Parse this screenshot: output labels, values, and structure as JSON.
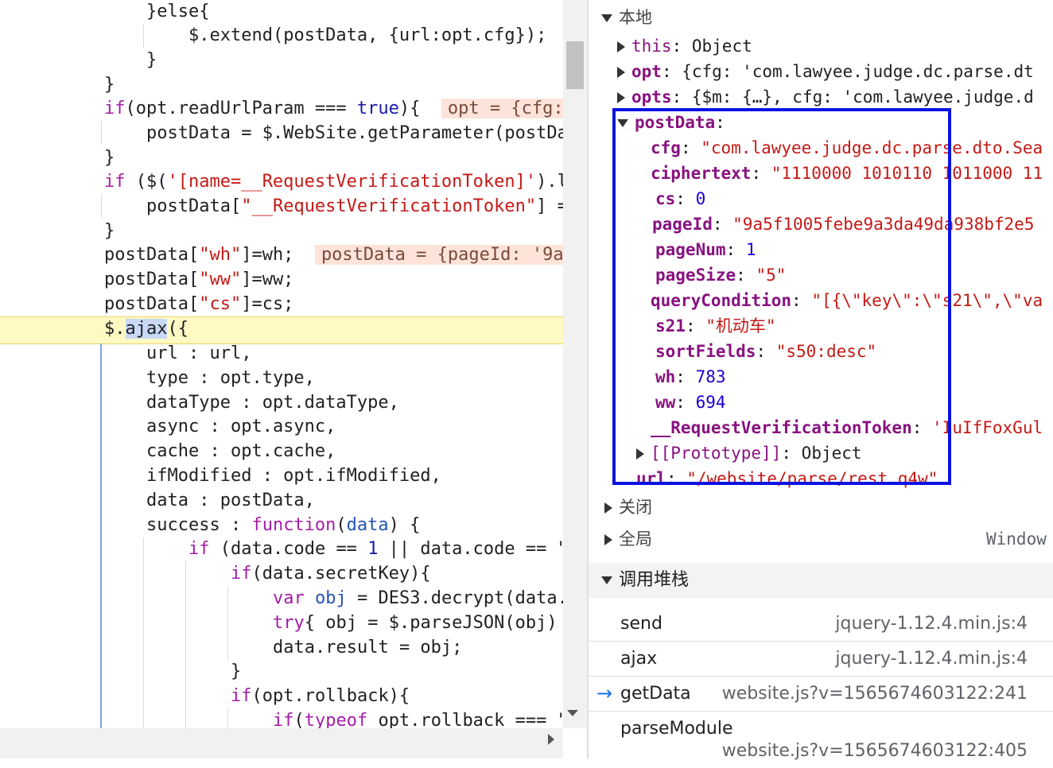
{
  "code": {
    "l1": "}else{",
    "l2": "$.extend(postData, {url:opt.cfg});",
    "l3": "}",
    "l4": "}",
    "l5a": "if",
    "l5b": "(opt.readUrlParam === ",
    "l5c": "true",
    "l5d": "){",
    "l5val": "opt = {cfg:",
    "l6": "postData = $.WebSite.getParameter(postDa",
    "l7": "}",
    "l8a": "if",
    "l8b": " ($(",
    "l8c": "'[name=__RequestVerificationToken]'",
    "l8d": ").l",
    "l9a": "postData[",
    "l9b": "\"__RequestVerificationToken\"",
    "l9c": "] =",
    "l10": "}",
    "l11a": "postData[",
    "l11b": "\"wh\"",
    "l11c": "]=wh;",
    "l11val": "postData = {pageId: '9a5",
    "l12a": "postData[",
    "l12b": "\"ww\"",
    "l12c": "]=ww;",
    "l13a": "postData[",
    "l13b": "\"cs\"",
    "l13c": "]=cs;",
    "l14a": "$.",
    "l14b": "ajax",
    "l14c": "({",
    "l15": "url : url,",
    "l16": "type : opt.type,",
    "l17": "dataType : opt.dataType,",
    "l18": "async : opt.async,",
    "l19": "cache : opt.cache,",
    "l20": "ifModified : opt.ifModified,",
    "l21": "data : postData,",
    "l22a": "success : ",
    "l22b": "function",
    "l22c": "(",
    "l22d": "data",
    "l22e": ") {",
    "l23a": "if",
    "l23b": " (data.code == ",
    "l23c": "1",
    "l23d": " || data.code == \"",
    "l24a": "if",
    "l24b": "(data.secretKey){",
    "l25a": "var",
    "l25b": " ",
    "l25c": "obj",
    "l25d": " = DES3.decrypt(data.",
    "l26a": "try",
    "l26b": "{ obj = $.parseJSON(obj)",
    "l27": "data.result = obj;",
    "l28": "}",
    "l29a": "if",
    "l29b": "(opt.rollback){",
    "l30a": "if",
    "l30b": "(",
    "l30c": "typeof",
    "l30d": " opt.rollback === \""
  },
  "scope": {
    "local_label": "本地",
    "this_key": "this",
    "this_val": "Object",
    "opt_key": "opt",
    "opt_val": "{cfg: 'com.lawyee.judge.dc.parse.dt",
    "opts_key": "opts",
    "opts_val": "{$m: {…}, cfg: 'com.lawyee.judge.d",
    "postdata_key": "postData",
    "cfg_key": "cfg",
    "cfg_val": "\"com.lawyee.judge.dc.parse.dto.Sea",
    "ciphertext_key": "ciphertext",
    "ciphertext_val": "\"1110000 1010110 1011000 11",
    "cs_key": "cs",
    "cs_val": "0",
    "pageid_key": "pageId",
    "pageid_val": "\"9a5f1005febe9a3da49da938bf2e5",
    "pagenum_key": "pageNum",
    "pagenum_val": "1",
    "pagesize_key": "pageSize",
    "pagesize_val": "\"5\"",
    "query_key": "queryCondition",
    "query_val": "\"[{\\\"key\\\":\\\"s21\\\",\\\"va",
    "s21_key": "s21",
    "s21_val": "\"机动车\"",
    "sort_key": "sortFields",
    "sort_val": "\"s50:desc\"",
    "wh_key": "wh",
    "wh_val": "783",
    "ww_key": "ww",
    "ww_val": "694",
    "token_key": "__RequestVerificationToken",
    "token_val": "'IuIfFoxGul",
    "proto_key": "[[Prototype]]",
    "proto_val": "Object",
    "url_key": "url",
    "url_val": "\"/website/parse/rest.q4w\"",
    "closure_label": "关闭",
    "global_label": "全局",
    "global_val": "Window"
  },
  "callstack": {
    "title": "调用堆栈",
    "frames": [
      {
        "fn": "send",
        "loc": "jquery-1.12.4.min.js:4"
      },
      {
        "fn": "ajax",
        "loc": "jquery-1.12.4.min.js:4"
      },
      {
        "fn": "getData",
        "loc": "website.js?v=1565674603122:241"
      },
      {
        "fn": "parseModule",
        "loc": "website.js?v=1565674603122:405"
      }
    ]
  },
  "colors": {
    "highlight_box": "#0a12e0",
    "current_line": "#fff9c4",
    "inline_value_bg": "#fde3da"
  }
}
